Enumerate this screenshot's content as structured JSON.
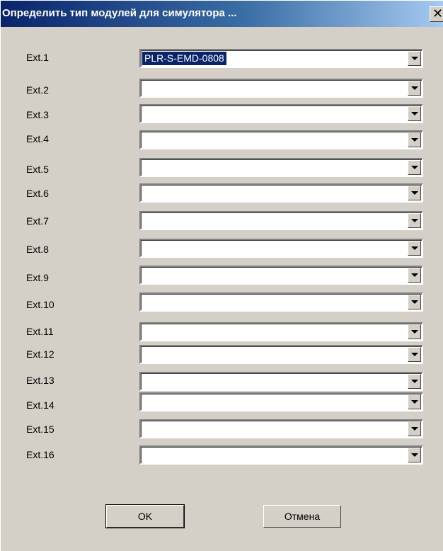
{
  "window": {
    "title": "Определить тип модулей для симулятора ...",
    "close_glyph": "✕"
  },
  "modules": [
    {
      "label": "Ext.1",
      "value": "PLR-S-EMD-0808"
    },
    {
      "label": "Ext.2",
      "value": ""
    },
    {
      "label": "Ext.3",
      "value": ""
    },
    {
      "label": "Ext.4",
      "value": ""
    },
    {
      "label": "Ext.5",
      "value": ""
    },
    {
      "label": "Ext.6",
      "value": ""
    },
    {
      "label": "Ext.7",
      "value": ""
    },
    {
      "label": "Ext.8",
      "value": ""
    },
    {
      "label": "Ext.9",
      "value": ""
    },
    {
      "label": "Ext.10",
      "value": ""
    },
    {
      "label": "Ext.11",
      "value": ""
    },
    {
      "label": "Ext.12",
      "value": ""
    },
    {
      "label": "Ext.13",
      "value": ""
    },
    {
      "label": "Ext.14",
      "value": ""
    },
    {
      "label": "Ext.15",
      "value": ""
    },
    {
      "label": "Ext.16",
      "value": ""
    }
  ],
  "buttons": {
    "ok": "OK",
    "cancel": "Отмена"
  }
}
